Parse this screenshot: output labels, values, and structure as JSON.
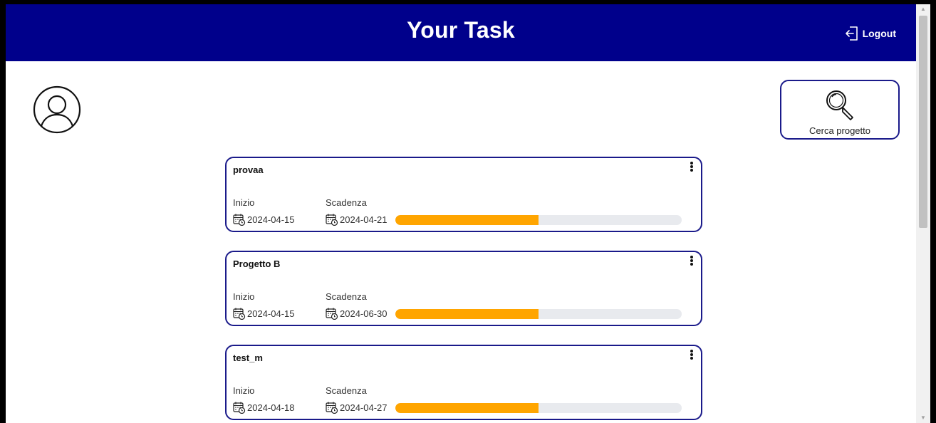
{
  "header": {
    "title": "Your Task",
    "logout_label": "Logout"
  },
  "search": {
    "label": "Cerca progetto"
  },
  "labels": {
    "start": "Inizio",
    "end": "Scadenza"
  },
  "colors": {
    "header_bg": "#00008b",
    "progress_fill": "#ffa500",
    "progress_track": "#e8eaee",
    "card_border": "#1a1a8a"
  },
  "projects": [
    {
      "name": "provaa",
      "start": "2024-04-15",
      "end": "2024-04-21",
      "progress": 0.5
    },
    {
      "name": "Progetto B",
      "start": "2024-04-15",
      "end": "2024-06-30",
      "progress": 0.5
    },
    {
      "name": "test_m",
      "start": "2024-04-18",
      "end": "2024-04-27",
      "progress": 0.5
    }
  ]
}
